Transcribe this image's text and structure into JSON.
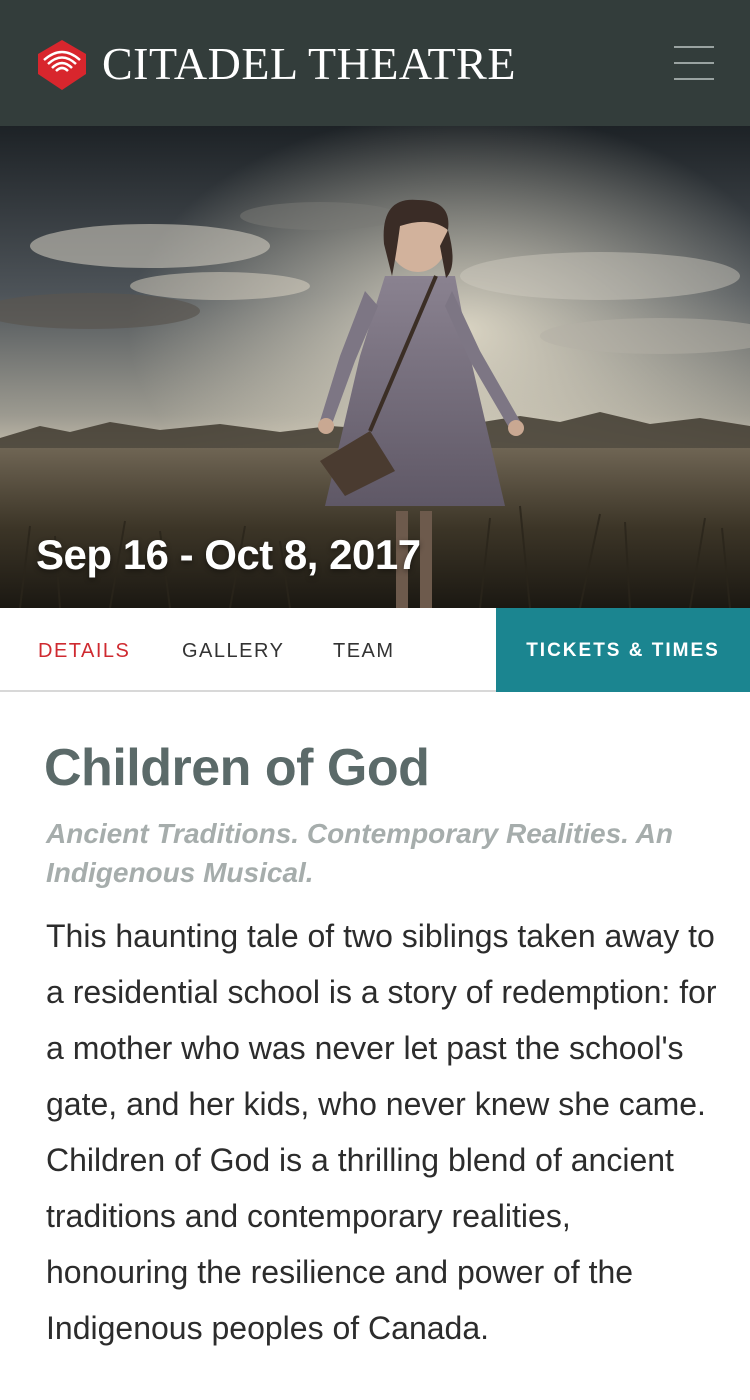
{
  "header": {
    "brand": "CITADEL THEATRE",
    "logo_icon": "citadel-logo-icon",
    "menu_icon": "hamburger-menu-icon",
    "colors": {
      "background": "#333d3b",
      "logo_red": "#d8262d"
    }
  },
  "hero": {
    "image": "woman-in-grey-dress-standing-in-field-under-stormy-sky",
    "date_range": "Sep 16 - Oct 8, 2017"
  },
  "tabs": {
    "items": [
      {
        "label": "DETAILS",
        "active": true
      },
      {
        "label": "GALLERY",
        "active": false
      },
      {
        "label": "TEAM",
        "active": false
      }
    ],
    "tickets_label": "TICKETS & TIMES",
    "colors": {
      "active": "#cf2a30",
      "tickets_bg": "#1b8590"
    }
  },
  "show": {
    "title": "Children of God",
    "subtitle": "Ancient Traditions. Contemporary Realities. An Indigenous Musical.",
    "description": "This haunting tale of two siblings taken away to a residential school is a story of redemption: for a mother who was never let past the school's gate, and her kids, who never knew she came. Children of God is a thrilling blend of ancient traditions and contemporary realities, honouring the resilience and power of the Indigenous peoples of Canada."
  }
}
